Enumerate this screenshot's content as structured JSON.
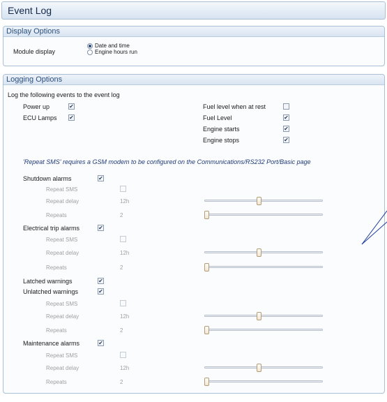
{
  "title": "Event Log",
  "display_options": {
    "header": "Display Options",
    "module_display_label": "Module display",
    "radio_options": [
      {
        "label": "Date and time",
        "selected": true
      },
      {
        "label": "Engine hours run",
        "selected": false
      }
    ]
  },
  "logging_options": {
    "header": "Logging Options",
    "intro": "Log the following events to the event log",
    "left_events": [
      {
        "label": "Power up",
        "checked": true
      },
      {
        "label": "ECU Lamps",
        "checked": true
      }
    ],
    "right_events": [
      {
        "label": "Fuel level when at rest",
        "checked": false
      },
      {
        "label": "Fuel Level",
        "checked": true
      },
      {
        "label": "Engine starts",
        "checked": true
      },
      {
        "label": "Engine stops",
        "checked": true
      }
    ],
    "sms_note": "'Repeat SMS' requires a GSM modem to be configured on the Communications/RS232 Port/Basic page",
    "sub_labels": {
      "repeat_sms": "Repeat SMS",
      "repeat_delay": "Repeat delay",
      "repeats": "Repeats"
    },
    "alarms": [
      {
        "label": "Shutdown alarms",
        "checked": true,
        "repeat_sms_checked": false,
        "repeat_delay": "12h",
        "repeats": "2",
        "delay_level": 0.46,
        "repeats_level": 0.0
      },
      {
        "label": "Electrical trip alarms",
        "checked": true,
        "repeat_sms_checked": false,
        "repeat_delay": "12h",
        "repeats": "2",
        "delay_level": 0.46,
        "repeats_level": 0.0
      },
      {
        "label": "Latched warnings",
        "checked": true
      },
      {
        "label": "Unlatched warnings",
        "checked": true,
        "repeat_sms_checked": false,
        "repeat_delay": "12h",
        "repeats": "2",
        "delay_level": 0.46,
        "repeats_level": 0.0
      },
      {
        "label": "Maintenance alarms",
        "checked": true,
        "repeat_sms_checked": false,
        "repeat_delay": "12h",
        "repeats": "2",
        "delay_level": 0.46,
        "repeats_level": 0.0
      }
    ]
  },
  "check_glyph": "✔",
  "colors": {
    "header_text": "#2a4f7c",
    "note_text": "#1f3a78",
    "pointer": "#1f3a9a"
  }
}
